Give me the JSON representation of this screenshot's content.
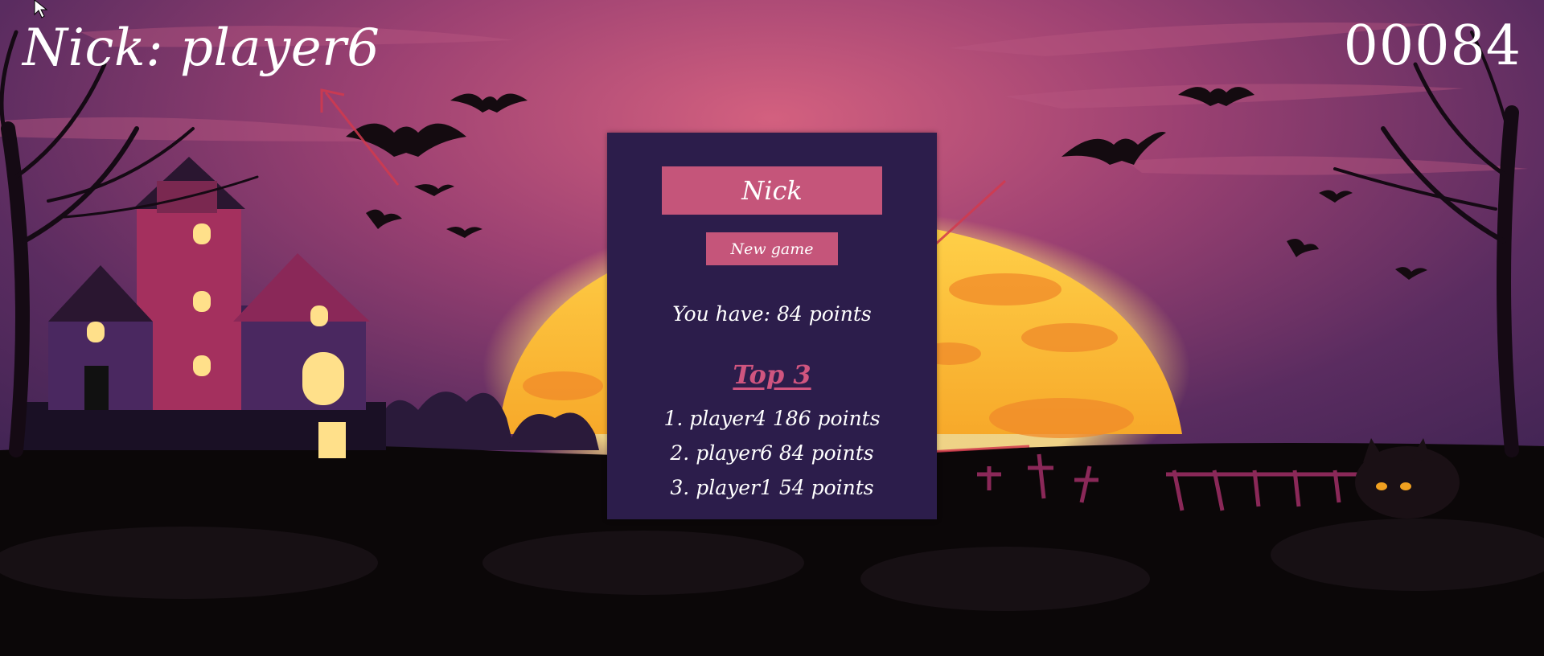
{
  "hud": {
    "nick_text": "Nick: player6",
    "score": "00084"
  },
  "dialog": {
    "name_input_value": "Nick",
    "new_game_label": "New game",
    "points_text": "You have: 84 points",
    "top_title": "Top 3",
    "leaderboard": [
      "1. player4 186 points",
      "2. player6 84 points",
      "3. player1 54 points"
    ]
  },
  "colors": {
    "panel_bg": "#2c1d4b",
    "button_bg": "#c5557a",
    "top_title": "#d0557f",
    "moon": "#f8b931",
    "sky_top": "#4a2a5c",
    "sky_glow": "#c55a80",
    "annotation_arrow": "#d23a4e"
  },
  "icons": [
    "bat-icon",
    "haunted-house",
    "moon",
    "tree",
    "cat",
    "fence",
    "cross",
    "mouse-cursor-icon",
    "annotation-arrow"
  ]
}
